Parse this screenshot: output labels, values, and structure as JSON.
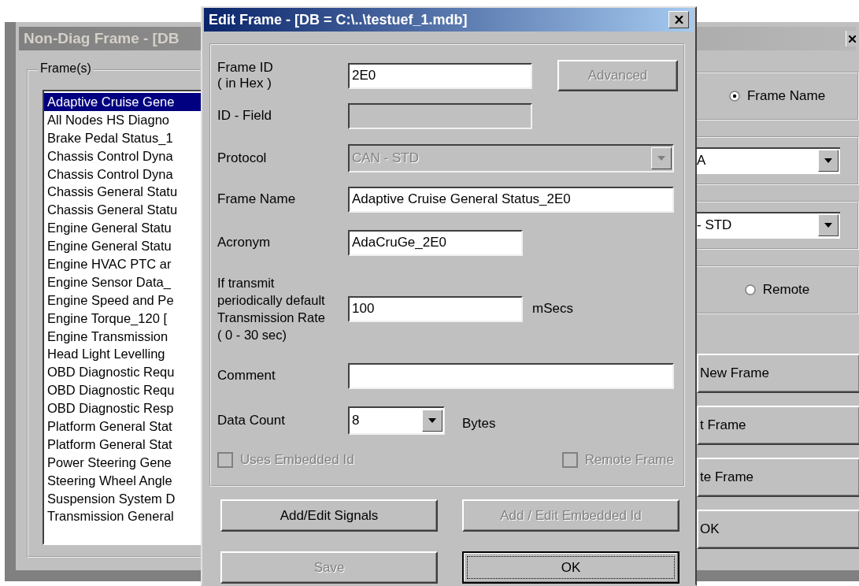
{
  "background_window": {
    "title": "Non-Diag Frame - [DB",
    "frames_group": {
      "label": "Frame(s)",
      "items": [
        {
          "text": "Adaptive Cruise Gene",
          "selected": true
        },
        {
          "text": "All Nodes HS Diagno",
          "selected": false
        },
        {
          "text": "Brake Pedal Status_1",
          "selected": false
        },
        {
          "text": "Chassis Control Dyna",
          "selected": false
        },
        {
          "text": "Chassis Control Dyna",
          "selected": false
        },
        {
          "text": "Chassis General Statu",
          "selected": false
        },
        {
          "text": "Chassis General Statu",
          "selected": false
        },
        {
          "text": "Engine General Statu",
          "selected": false
        },
        {
          "text": "Engine General Statu",
          "selected": false
        },
        {
          "text": "Engine HVAC PTC ar",
          "selected": false
        },
        {
          "text": "Engine Sensor Data_",
          "selected": false
        },
        {
          "text": "Engine Speed and Pe",
          "selected": false
        },
        {
          "text": "Engine Torque_120 [",
          "selected": false
        },
        {
          "text": "Engine Transmission",
          "selected": false
        },
        {
          "text": "Head Light Levelling",
          "selected": false
        },
        {
          "text": "OBD Diagnostic Requ",
          "selected": false
        },
        {
          "text": "OBD Diagnostic Requ",
          "selected": false
        },
        {
          "text": "OBD Diagnostic Resp",
          "selected": false
        },
        {
          "text": "Platform General Stat",
          "selected": false
        },
        {
          "text": "Platform General Stat",
          "selected": false
        },
        {
          "text": "Power Steering Gene",
          "selected": false
        },
        {
          "text": "Steering Wheel Angle",
          "selected": false
        },
        {
          "text": "Suspension System D",
          "selected": false
        },
        {
          "text": "Transmission General",
          "selected": false
        }
      ]
    },
    "right_groups": [
      {
        "kind": "radio",
        "label": "Frame Name",
        "selected": true
      },
      {
        "kind": "dropdown",
        "value": "A"
      },
      {
        "kind": "dropdown",
        "value": "- STD"
      },
      {
        "kind": "radio",
        "label": "Remote",
        "selected": false
      }
    ],
    "right_buttons": [
      "New Frame",
      "t Frame",
      "te Frame",
      "OK"
    ]
  },
  "dialog": {
    "title": "Edit Frame - [DB = C:\\..\\testuef_1.mdb]",
    "frame_id": {
      "label_lines": [
        "Frame ID",
        "( in Hex )"
      ],
      "value": "2E0"
    },
    "advanced_button": {
      "label": "Advanced",
      "disabled": true
    },
    "id_field": {
      "label": "ID - Field",
      "disabled": true
    },
    "protocol": {
      "label": "Protocol",
      "value": "CAN - STD",
      "disabled": true
    },
    "frame_name": {
      "label": "Frame Name",
      "value": "Adaptive Cruise General Status_2E0"
    },
    "acronym": {
      "label": "Acronym",
      "value": "AdaCruGe_2E0"
    },
    "transmission_rate": {
      "label_lines": [
        "If transmit",
        "periodically default",
        "Transmission Rate",
        "( 0 - 30 sec)"
      ],
      "value": "100",
      "unit": "mSecs"
    },
    "comment": {
      "label": "Comment"
    },
    "data_count": {
      "label": "Data Count",
      "value": "8",
      "unit": "Bytes"
    },
    "checkboxes": [
      {
        "label": "Uses Embedded Id",
        "checked": false,
        "disabled": true
      },
      {
        "label": "Remote Frame",
        "checked": false,
        "disabled": true
      }
    ],
    "buttons": [
      {
        "label": "Add/Edit Signals",
        "disabled": false,
        "default": false
      },
      {
        "label": "Add / Edit Embedded Id",
        "disabled": true,
        "default": false
      },
      {
        "label": "Save",
        "disabled": true,
        "default": false
      },
      {
        "label": "OK",
        "disabled": false,
        "default": true
      }
    ]
  }
}
